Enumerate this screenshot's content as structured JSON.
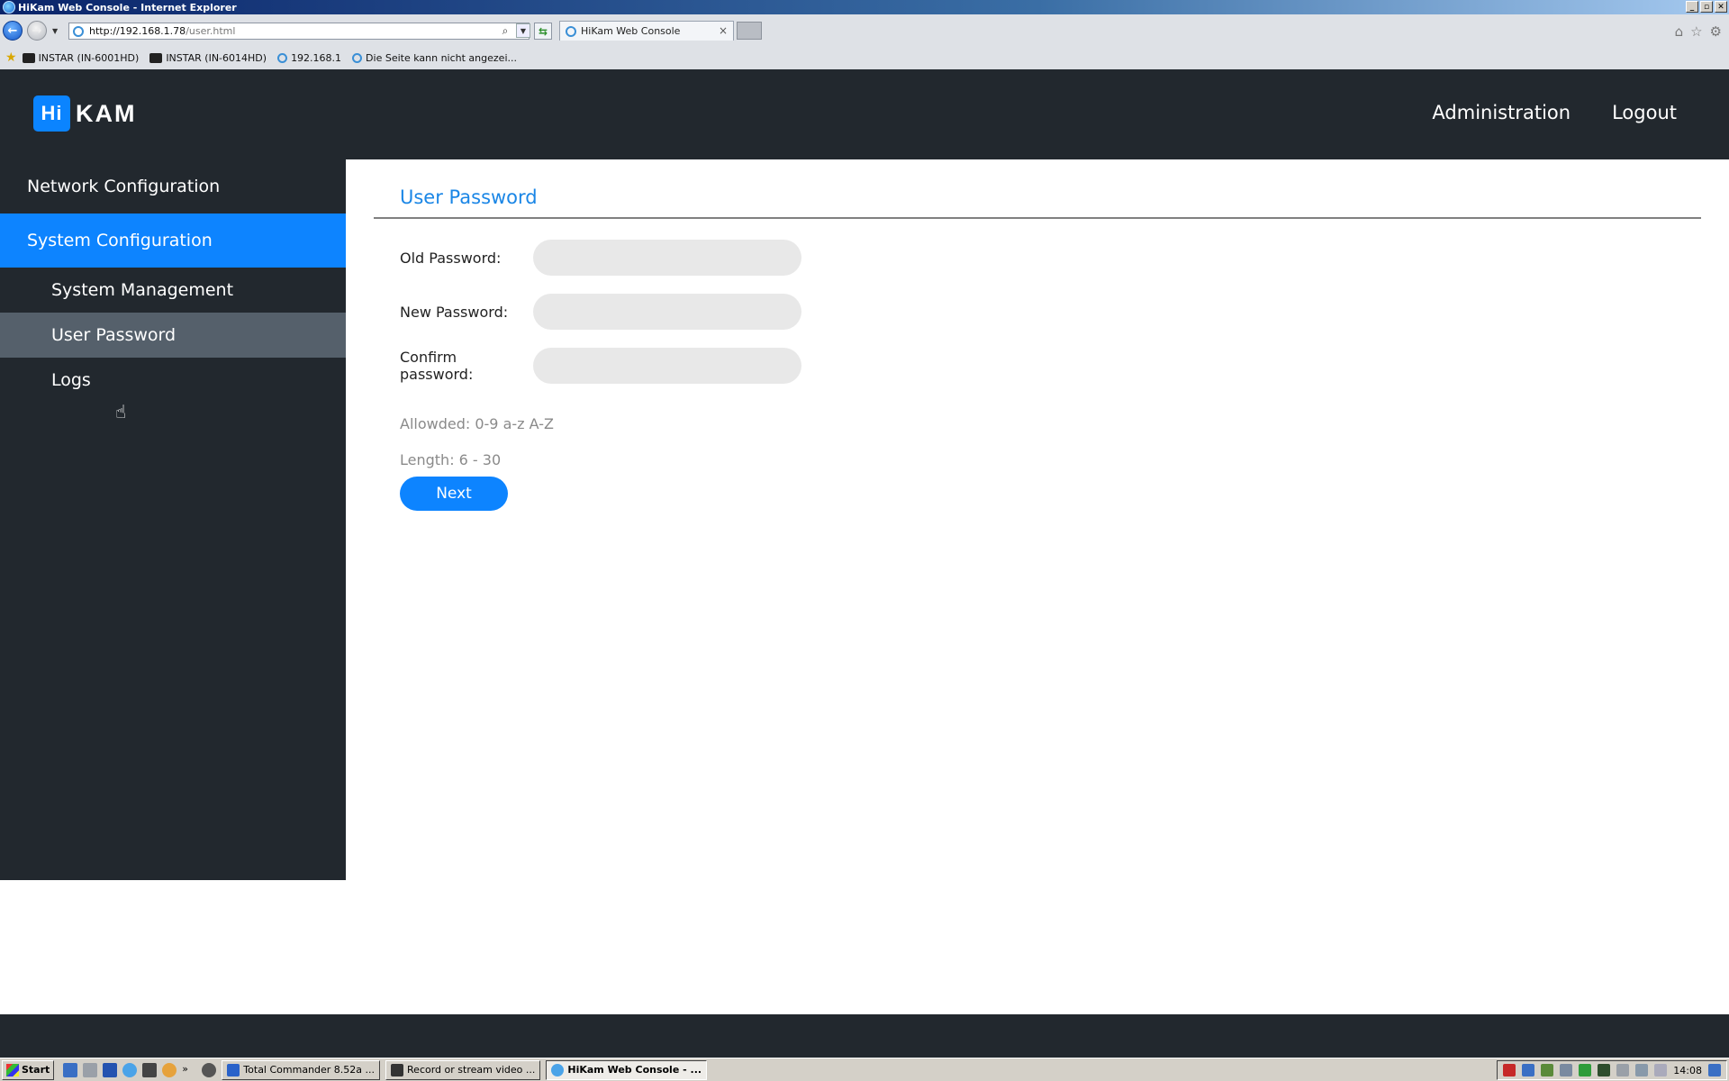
{
  "window": {
    "title": "HiKam Web Console - Internet Explorer",
    "controls": [
      "_",
      "▫",
      "✕"
    ]
  },
  "browser": {
    "address_host": "http://192.168.1.78",
    "address_path": "/user.html",
    "tab_title": "HiKam Web Console",
    "tab_close": "×",
    "favorites": [
      "INSTAR (IN-6001HD)",
      "INSTAR (IN-6014HD)",
      "192.168.1",
      "Die Seite kann nicht angezei..."
    ]
  },
  "header": {
    "logo_box": "Hi",
    "logo_text": "KAM",
    "nav": [
      "Administration",
      "Logout"
    ]
  },
  "sidebar": {
    "sections": [
      {
        "label": "Network Configuration"
      },
      {
        "label": "System Configuration",
        "active": true
      }
    ],
    "items": [
      {
        "label": "System Management"
      },
      {
        "label": "User Password",
        "selected": true
      },
      {
        "label": "Logs"
      }
    ]
  },
  "content": {
    "title": "User Password",
    "fields": [
      {
        "label": "Old Password:",
        "value": "",
        "placeholder": ""
      },
      {
        "label": "New Password:",
        "value": "",
        "placeholder": ""
      },
      {
        "label": "Confirm password:",
        "value": "",
        "placeholder": ""
      }
    ],
    "hint_allowed": "Allowded: 0-9 a-z A-Z",
    "hint_length": "Length: 6 - 30",
    "next_label": "Next"
  },
  "taskbar": {
    "start_label": "Start",
    "tasks": [
      {
        "label": "Total Commander 8.52a ..."
      },
      {
        "label": "Record or stream video ..."
      },
      {
        "label": "HiKam Web Console - ...",
        "active": true
      }
    ],
    "clock": "14:08"
  },
  "colors": {
    "accent": "#0d84ff",
    "header_bg": "#22282e",
    "sidebar_selected": "#55606b",
    "title_blue": "#1a86e6"
  }
}
